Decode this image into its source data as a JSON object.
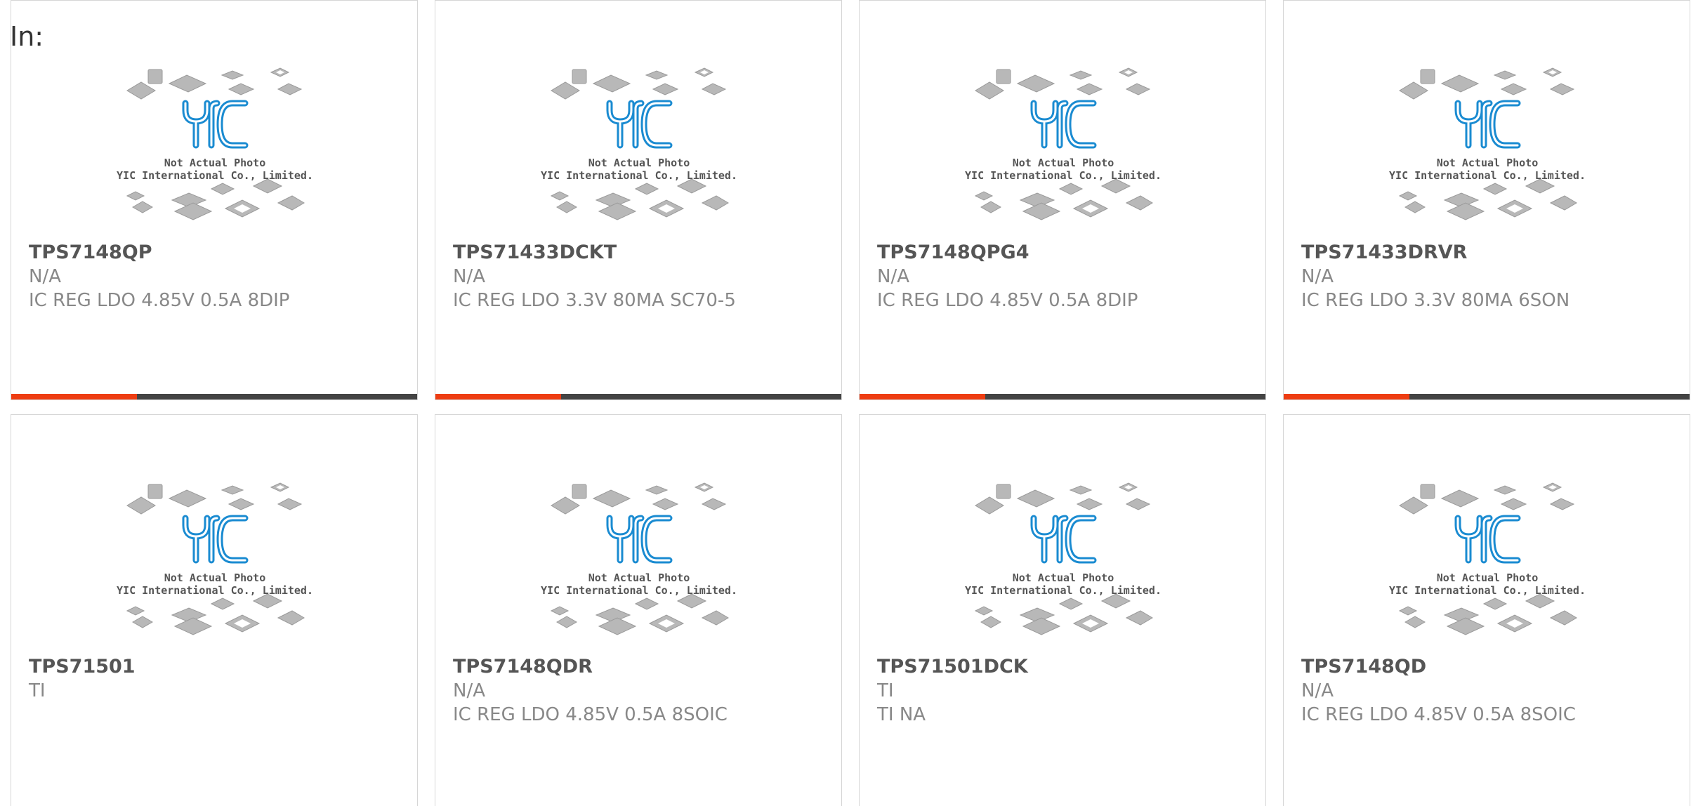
{
  "header": {
    "label": "In:"
  },
  "thumbnail": {
    "caption_line1": "Not Actual Photo",
    "caption_line2": "YIC International Co., Limited.",
    "logo_text": "YIC",
    "logo_color": "#1a8bd1"
  },
  "colors": {
    "accent": "#ee3d12",
    "bar_dark": "#444444",
    "border": "#d6d6d6"
  },
  "products": [
    {
      "part": "TPS7148QP",
      "manufacturer": "N/A",
      "description": "IC REG LDO 4.85V 0.5A 8DIP",
      "progress": 0.31
    },
    {
      "part": "TPS71433DCKT",
      "manufacturer": "N/A",
      "description": "IC REG LDO 3.3V 80MA SC70-5",
      "progress": 0.31
    },
    {
      "part": "TPS7148QPG4",
      "manufacturer": "N/A",
      "description": "IC REG LDO 4.85V 0.5A 8DIP",
      "progress": 0.31
    },
    {
      "part": "TPS71433DRVR",
      "manufacturer": "N/A",
      "description": "IC REG LDO 3.3V 80MA 6SON",
      "progress": 0.31
    },
    {
      "part": "TPS71501",
      "manufacturer": "TI",
      "description": ""
    },
    {
      "part": "TPS7148QDR",
      "manufacturer": "N/A",
      "description": "IC REG LDO 4.85V 0.5A 8SOIC"
    },
    {
      "part": "TPS71501DCK",
      "manufacturer": "TI",
      "description": "TI NA"
    },
    {
      "part": "TPS7148QD",
      "manufacturer": "N/A",
      "description": "IC REG LDO 4.85V 0.5A 8SOIC"
    }
  ]
}
